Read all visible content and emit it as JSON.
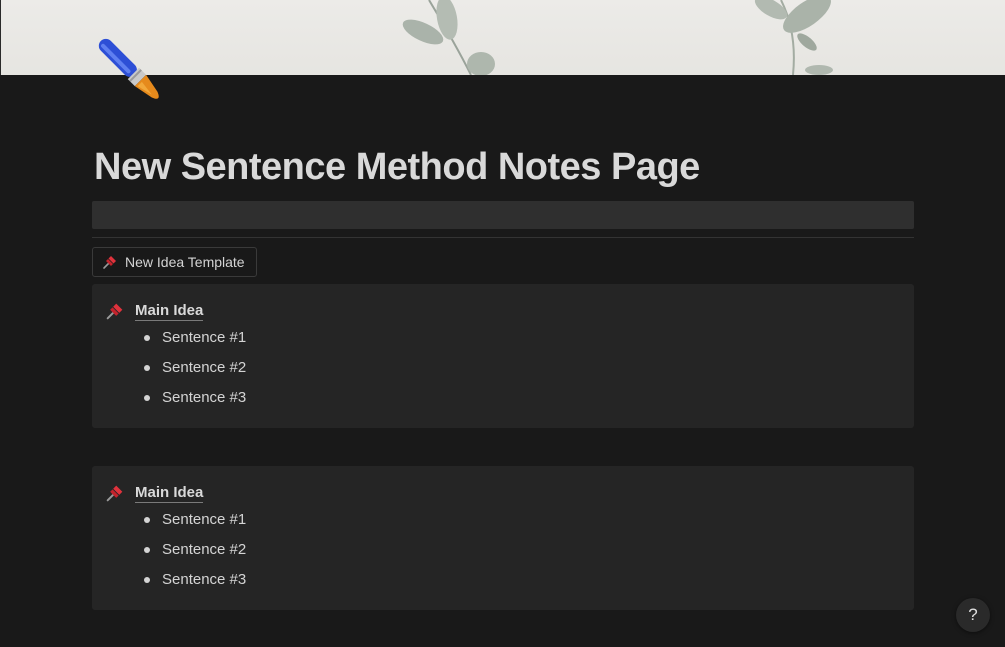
{
  "page": {
    "title": "New Sentence Method Notes Page",
    "icon": "paintbrush-icon",
    "cover": "eucalyptus-leaves-cover"
  },
  "template_button": {
    "icon": "pushpin-icon",
    "label": "New Idea Template"
  },
  "callouts": [
    {
      "icon": "pushpin-icon",
      "heading": "Main Idea",
      "items": [
        "Sentence #1",
        "Sentence #2",
        "Sentence #3"
      ]
    },
    {
      "icon": "pushpin-icon",
      "heading": "Main Idea",
      "items": [
        "Sentence #1",
        "Sentence #2",
        "Sentence #3"
      ]
    }
  ],
  "help": {
    "label": "?"
  },
  "colors": {
    "background": "#191919",
    "callout_background": "#252525",
    "text": "#d4d4d4"
  }
}
